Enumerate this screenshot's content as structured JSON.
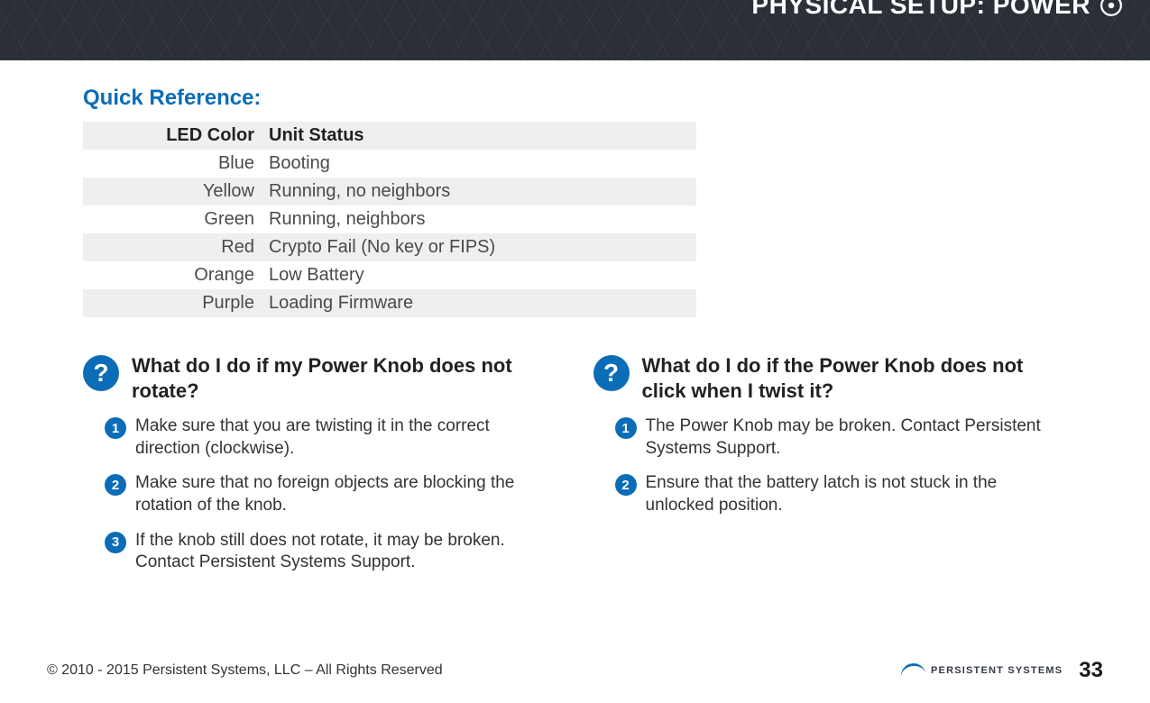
{
  "header": {
    "title": "PHYSICAL SETUP:  POWER"
  },
  "quick_ref": {
    "heading": "Quick Reference:",
    "col1_header": "LED Color",
    "col2_header": "Unit Status",
    "rows": [
      {
        "color": "Blue",
        "status": "Booting"
      },
      {
        "color": "Yellow",
        "status": "Running, no neighbors"
      },
      {
        "color": "Green",
        "status": "Running, neighbors"
      },
      {
        "color": "Red",
        "status": "Crypto Fail (No key or FIPS)"
      },
      {
        "color": "Orange",
        "status": "Low Battery"
      },
      {
        "color": "Purple",
        "status": "Loading Firmware"
      }
    ]
  },
  "faq": {
    "q_badge": "?",
    "left": {
      "question": "What do I do if my Power Knob does not rotate?",
      "steps": [
        "Make sure that you are twisting it in the correct direction (clockwise).",
        "Make sure that no foreign objects are blocking the rotation of the knob.",
        "If the knob still does not rotate, it may be broken. Contact Persistent Systems Support."
      ],
      "nums": [
        "1",
        "2",
        "3"
      ]
    },
    "right": {
      "question": "What do I do if the Power Knob does not click when I twist it?",
      "steps": [
        "The Power Knob may be broken. Contact Persistent Systems Support.",
        "Ensure that the battery latch is not stuck in the unlocked position."
      ],
      "nums": [
        "1",
        "2"
      ]
    }
  },
  "footer": {
    "copyright": "© 2010 - 2015 Persistent Systems, LLC – All Rights Reserved",
    "logo_text": "PERSISTENT SYSTEMS",
    "page_number": "33"
  }
}
